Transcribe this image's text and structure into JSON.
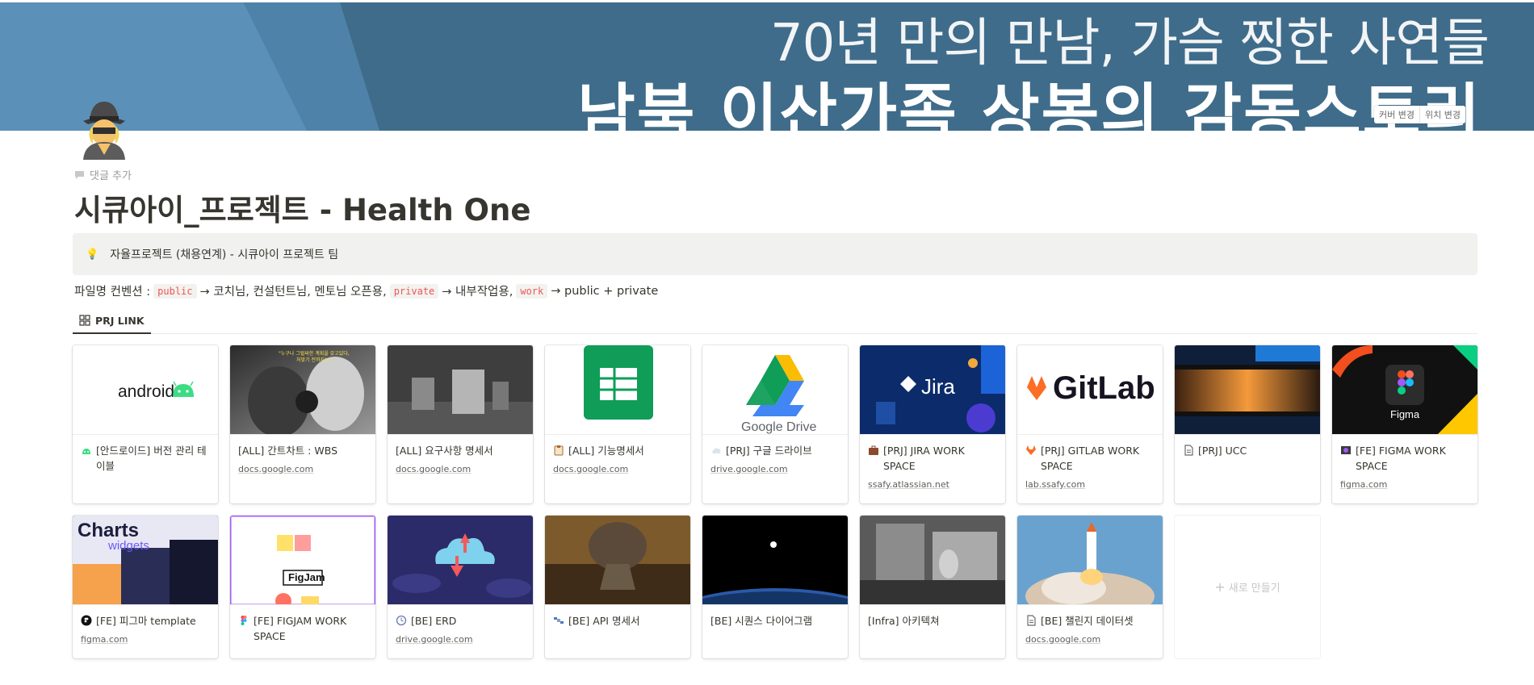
{
  "cover": {
    "line1": "70년 만의 만남, 가슴 찡한 사연들",
    "line2": "남북 이산가족 상봉의 감동스토리",
    "change_cover": "커버 변경",
    "reposition": "위치 변경"
  },
  "page": {
    "icon": "detective-emoji",
    "add_comment": "댓글 추가",
    "title": "시큐아이_프로젝트 - Health One",
    "callout_icon": "💡",
    "callout_text": "자율프로젝트 (채용연계) - 시큐아이 프로젝트 팀",
    "convention": {
      "prefix": "파일명 컨벤션 :",
      "code1": "public",
      "text1": "→ 코치님, 컨설턴트님, 멘토님 오픈용,",
      "code2": "private",
      "text2": "→ 내부작업용,",
      "code3": "work",
      "text3": "→ public + private"
    },
    "tab_label": "PRJ LINK"
  },
  "gallery": {
    "new_label": "새로 만들기",
    "cards": [
      {
        "title": "[안드로이드] 버전 관리 테이블",
        "url": "",
        "icon": "android-icon",
        "thumb": "android"
      },
      {
        "title": "[ALL] 간트차트 : WBS",
        "url": "docs.google.com",
        "icon": "",
        "thumb": "boxing"
      },
      {
        "title": "[ALL] 요구사항 명세서",
        "url": "docs.google.com",
        "icon": "",
        "thumb": "robots"
      },
      {
        "title": "[ALL] 기능명세서",
        "url": "docs.google.com",
        "icon": "clipboard-icon",
        "thumb": "sheets"
      },
      {
        "title": "[PRJ] 구글 드라이브",
        "url": "drive.google.com",
        "icon": "cloud-icon",
        "thumb": "drive"
      },
      {
        "title": "[PRJ] JIRA WORK SPACE",
        "url": "ssafy.atlassian.net",
        "icon": "briefcase-icon",
        "thumb": "jira"
      },
      {
        "title": "[PRJ] GITLAB WORK SPACE",
        "url": "lab.ssafy.com",
        "icon": "gitlab-icon",
        "thumb": "gitlab"
      },
      {
        "title": "[PRJ] UCC",
        "url": "",
        "icon": "document-icon",
        "thumb": "film"
      },
      {
        "title": "[FE] FIGMA WORK SPACE",
        "url": "figma.com",
        "icon": "figma-small-icon",
        "thumb": "figma"
      },
      {
        "title": "[FE] 피그마 template",
        "url": "figma.com",
        "icon": "figma-black-icon",
        "thumb": "charts"
      },
      {
        "title": "[FE] FIGJAM WORK SPACE",
        "url": "",
        "icon": "figma-color-icon",
        "thumb": "figjam"
      },
      {
        "title": "[BE] ERD",
        "url": "drive.google.com",
        "icon": "clock-icon",
        "thumb": "cloudarrows"
      },
      {
        "title": "[BE] API 명세서",
        "url": "",
        "icon": "satellite-icon",
        "thumb": "dish"
      },
      {
        "title": "[BE] 시퀀스 다이어그램",
        "url": "",
        "icon": "",
        "thumb": "space"
      },
      {
        "title": "[Infra] 아키텍쳐",
        "url": "",
        "icon": "",
        "thumb": "computer"
      },
      {
        "title": "[BE] 챌린지 데이터셋",
        "url": "docs.google.com",
        "icon": "document-icon",
        "thumb": "rocket"
      }
    ]
  }
}
